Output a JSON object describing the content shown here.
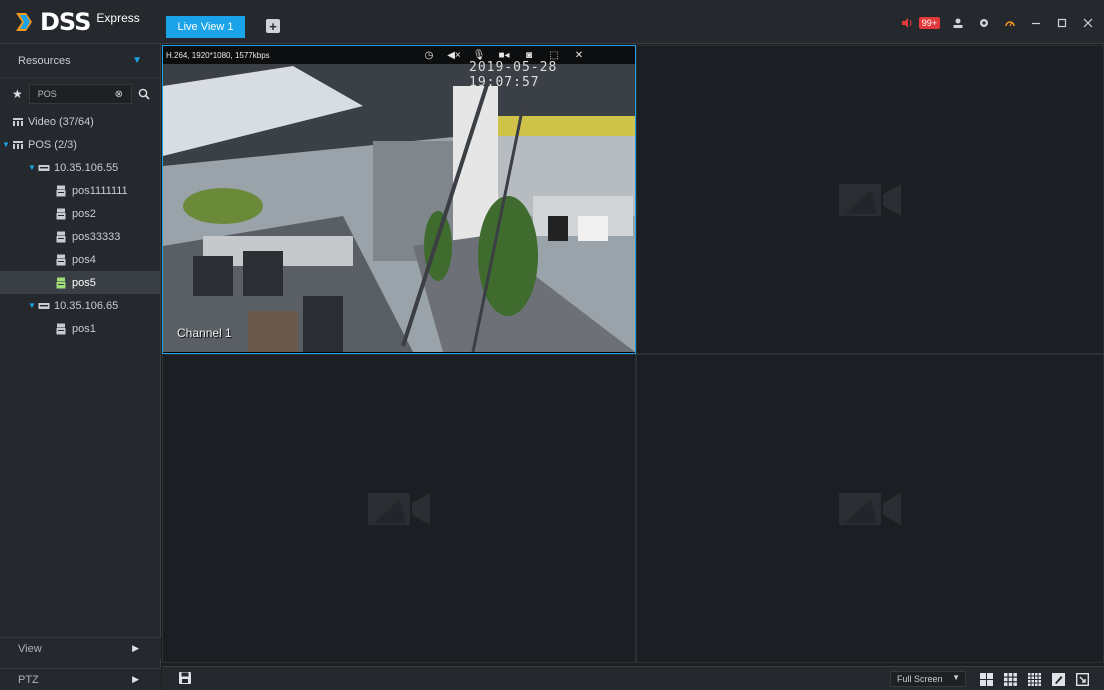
{
  "app": {
    "logo_main": "DSS",
    "logo_sub": "Express"
  },
  "tabs": {
    "active_label": "Live View 1",
    "add_label": "+"
  },
  "top_right": {
    "alarm_badge": "99+"
  },
  "sidebar": {
    "resources_label": "Resources",
    "search_value": "POS",
    "tree": [
      {
        "label": "Video (37/64)"
      },
      {
        "label": "POS (2/3)"
      },
      {
        "label": "10.35.106.55"
      },
      {
        "label": "pos1111111"
      },
      {
        "label": "pos2"
      },
      {
        "label": "pos33333"
      },
      {
        "label": "pos4"
      },
      {
        "label": "pos5"
      },
      {
        "label": "10.35.106.65"
      },
      {
        "label": "pos1"
      }
    ],
    "view_label": "View",
    "ptz_label": "PTZ"
  },
  "video": {
    "info": "H.264, 1920*1080, 1577kbps",
    "timestamp": "2019-05-28 19:07:57",
    "channel_name": "Channel 1"
  },
  "bottom": {
    "fullscreen_label": "Full Screen"
  },
  "colors": {
    "accent": "#1aa3e8",
    "badge": "#e23a3a",
    "background": "#1b1d21"
  }
}
